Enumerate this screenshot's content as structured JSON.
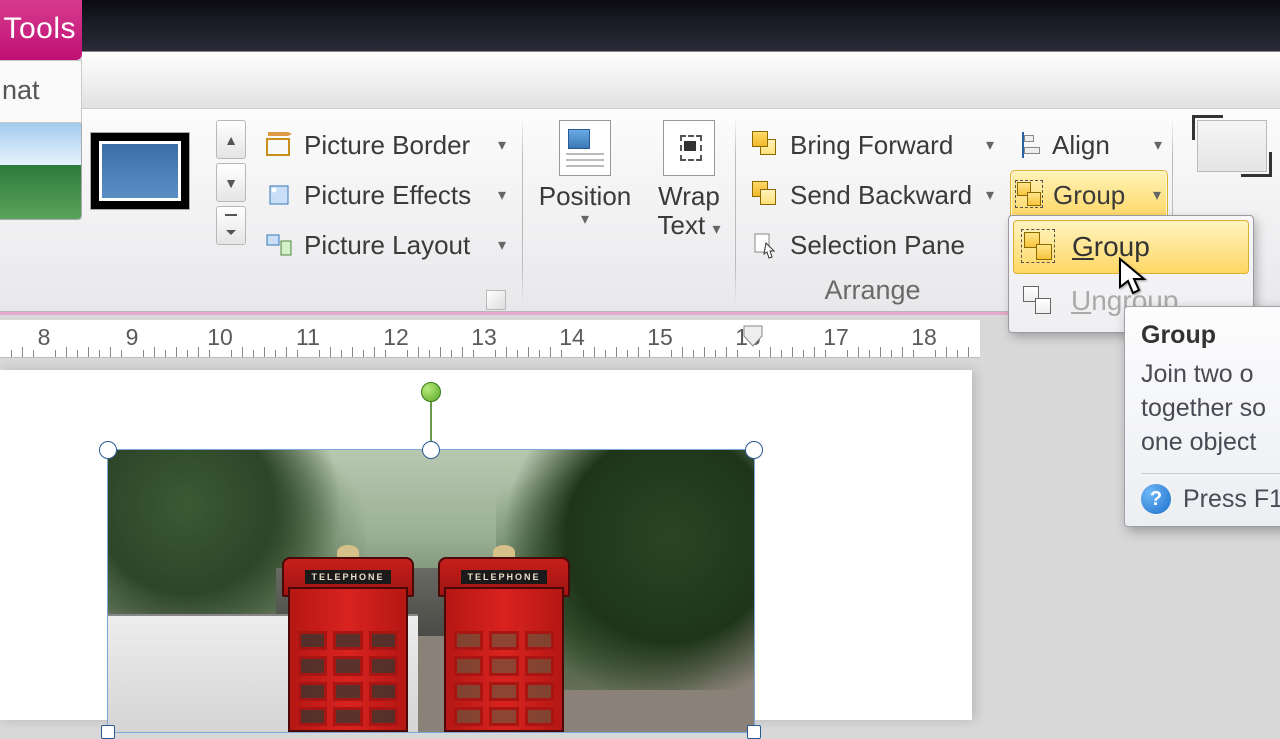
{
  "tabs": {
    "tools": "Tools",
    "format": "nat"
  },
  "picture_options": {
    "border": "Picture Border",
    "effects": "Picture Effects",
    "layout": "Picture Layout"
  },
  "position": {
    "label": "Position"
  },
  "wrap": {
    "line1": "Wrap",
    "line2": "Text"
  },
  "arrange": {
    "forward": "Bring Forward",
    "backward": "Send Backward",
    "selection": "Selection Pane",
    "group_label": "Arrange"
  },
  "align": {
    "align": "Align",
    "group": "Group"
  },
  "crop": "Crop",
  "menu": {
    "group": "Group",
    "group_u": "G",
    "group_rest": "roup",
    "ungroup": "Ungroup",
    "ungroup_u": "U",
    "ungroup_rest": "ngroup"
  },
  "tooltip": {
    "title": "Group",
    "body1": "Join two o",
    "body2": "together so",
    "body3": "one object",
    "help": "Press F1"
  },
  "booth_label": "TELEPHONE",
  "ruler_numbers": [
    "8",
    "9",
    "10",
    "11",
    "12",
    "13",
    "14",
    "15",
    "16",
    "17",
    "18"
  ]
}
